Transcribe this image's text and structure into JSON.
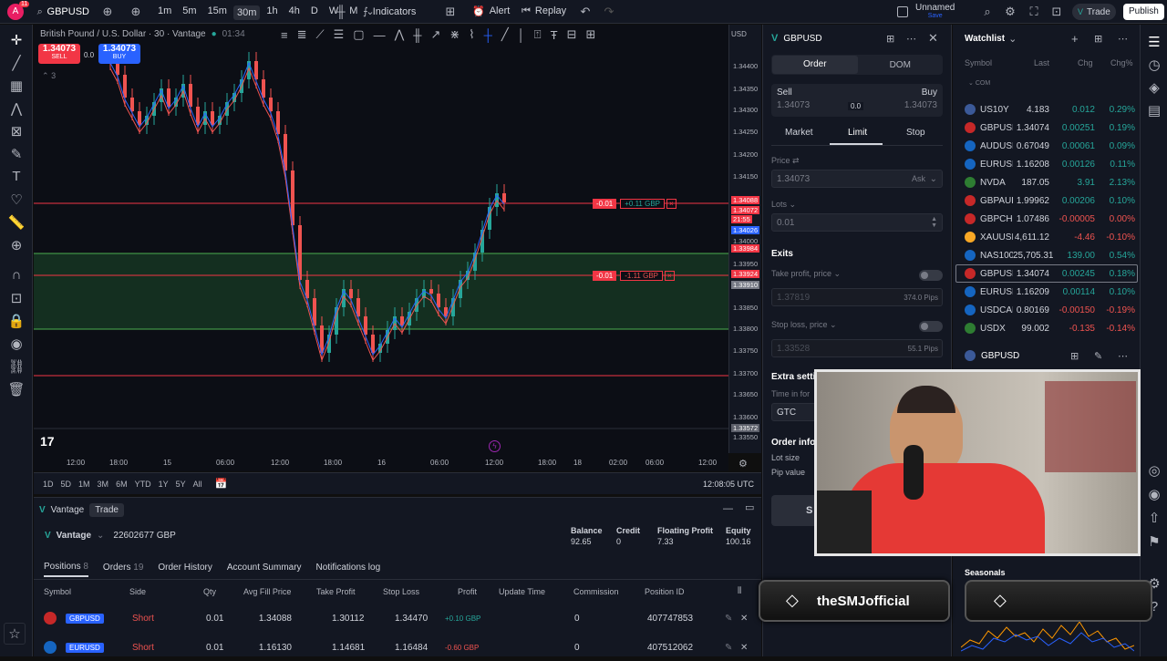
{
  "top_toolbar": {
    "symbol": "GBPUSD",
    "intervals": [
      "1m",
      "5m",
      "15m",
      "30m",
      "1h",
      "4h",
      "D",
      "W",
      "M"
    ],
    "active_interval": "30m",
    "indicators": "Indicators",
    "alert": "Alert",
    "replay": "Replay",
    "layout_name": "Unnamed",
    "layout_status": "Save",
    "trade": "Trade",
    "publish": "Publish",
    "avatar_badge": "11"
  },
  "chart": {
    "legend_title": "British Pound / U.S. Dollar · 30 · Vantage",
    "legend_time": "01:34",
    "sell_price": "1.34073",
    "sell_label": "SELL",
    "spread": "0.0",
    "buy_price": "1.34073",
    "buy_label": "BUY",
    "collapse_count": "3",
    "currency": "USD",
    "price_scale": [
      "1.34400",
      "1.34350",
      "1.34300",
      "1.34250",
      "1.34200",
      "1.34150",
      "1.34088",
      "1.34072",
      "21:55",
      "1.34026",
      "1.34000",
      "1.33984",
      "1.33950",
      "1.33924",
      "1.33910",
      "1.33850",
      "1.33800",
      "1.33750",
      "1.33700",
      "1.33650",
      "1.33600",
      "1.33572",
      "1.33550"
    ],
    "order_line_1": {
      "qty": "-0.01",
      "pnl": "+0.11 GBP"
    },
    "order_line_2": {
      "qty": "-0.01",
      "pnl": "-1.11 GBP"
    },
    "time_axis": [
      "12:00",
      "18:00",
      "15",
      "06:00",
      "12:00",
      "18:00",
      "16",
      "06:00",
      "12:00",
      "18:00",
      "18",
      "02:00",
      "06:00",
      "12:00"
    ],
    "ranges": [
      "1D",
      "5D",
      "1M",
      "3M",
      "6M",
      "YTD",
      "1Y",
      "5Y",
      "All"
    ],
    "clock": "12:08:05 UTC"
  },
  "order_panel": {
    "symbol": "GBPUSD",
    "tab_order": "Order",
    "tab_dom": "DOM",
    "sell_label": "Sell",
    "sell_price": "1.34073",
    "spread": "0.0",
    "buy_label": "Buy",
    "buy_price": "1.34073",
    "type_market": "Market",
    "type_limit": "Limit",
    "type_stop": "Stop",
    "price_label": "Price",
    "price_value": "1.34073",
    "price_suffix": "Ask",
    "lots_label": "Lots",
    "lots_value": "0.01",
    "exits_label": "Exits",
    "tp_label": "Take profit, price",
    "tp_value": "1.37819",
    "tp_pips": "374.0 Pips",
    "sl_label": "Stop loss, price",
    "sl_value": "1.33528",
    "sl_pips": "55.1 Pips",
    "extra_label": "Extra setti",
    "tif_label": "Time in for",
    "tif_value": "GTC",
    "order_info_label": "Order info",
    "lot_size_label": "Lot size",
    "pip_value_label": "Pip value",
    "submit_partial": "S"
  },
  "watchlist": {
    "title": "Watchlist",
    "headers": {
      "symbol": "Symbol",
      "last": "Last",
      "chg": "Chg",
      "chgp": "Chg%"
    },
    "section": "COM",
    "rows": [
      {
        "sym": "US10Y",
        "last": "4.183",
        "chg": "0.012",
        "chgp": "0.29%",
        "color": "#26a69a"
      },
      {
        "sym": "GBPUSD",
        "last": "1.34074",
        "chg": "0.00251",
        "chgp": "0.19%",
        "color": "#26a69a"
      },
      {
        "sym": "AUDUSD",
        "last": "0.67049",
        "chg": "0.00061",
        "chgp": "0.09%",
        "color": "#26a69a"
      },
      {
        "sym": "EURUSD",
        "last": "1.16208",
        "chg": "0.00126",
        "chgp": "0.11%",
        "color": "#26a69a"
      },
      {
        "sym": "NVDA",
        "last": "187.05",
        "chg": "3.91",
        "chgp": "2.13%",
        "color": "#26a69a"
      },
      {
        "sym": "GBPAUD",
        "last": "1.99962",
        "chg": "0.00206",
        "chgp": "0.10%",
        "color": "#26a69a"
      },
      {
        "sym": "GBPCHF",
        "last": "1.07486",
        "chg": "-0.00005",
        "chgp": "0.00%",
        "color": "#ef5350"
      },
      {
        "sym": "XAUUSD",
        "last": "4,611.12",
        "chg": "-4.46",
        "chgp": "-0.10%",
        "color": "#ef5350"
      },
      {
        "sym": "NAS100",
        "last": "25,705.31",
        "chg": "139.00",
        "chgp": "0.54%",
        "color": "#26a69a"
      },
      {
        "sym": "GBPUSD",
        "last": "1.34074",
        "chg": "0.00245",
        "chgp": "0.18%",
        "color": "#26a69a"
      },
      {
        "sym": "EURUSD",
        "last": "1.16209",
        "chg": "0.00114",
        "chgp": "0.10%",
        "color": "#26a69a"
      },
      {
        "sym": "USDCAD",
        "last": "0.80169",
        "chg": "-0.00150",
        "chgp": "-0.19%",
        "color": "#ef5350"
      },
      {
        "sym": "USDX",
        "last": "99.002",
        "chg": "-0.135",
        "chgp": "-0.14%",
        "color": "#ef5350"
      }
    ],
    "detail_symbol": "GBPUSD",
    "seasonals": "Seasonals"
  },
  "bottom_panel": {
    "broker": "Vantage",
    "tab_trade": "Trade",
    "account_broker": "Vantage",
    "account_id": "22602677 GBP",
    "balance_label": "Balance",
    "balance_value": "92.65",
    "credit_label": "Credit",
    "credit_value": "0",
    "floating_label": "Floating Profit",
    "floating_value": "7.33",
    "equity_label": "Equity",
    "equity_value": "100.16",
    "tabs": [
      "Positions",
      "Orders",
      "Order History",
      "Account Summary",
      "Notifications log"
    ],
    "positions_count": "8",
    "orders_count": "19",
    "columns": [
      "Symbol",
      "Side",
      "Qty",
      "Avg Fill Price",
      "Take Profit",
      "Stop Loss",
      "Profit",
      "Update Time",
      "Commission",
      "Position ID"
    ],
    "rows": [
      {
        "symbol": "GBPUSD",
        "side": "Short",
        "qty": "0.01",
        "avg": "1.34088",
        "tp": "1.30112",
        "sl": "1.34470",
        "profit": "+0.10 GBP",
        "commission": "0",
        "id": "407747853"
      },
      {
        "symbol": "EURUSD",
        "side": "Short",
        "qty": "0.01",
        "avg": "1.16130",
        "tp": "1.14681",
        "sl": "1.16484",
        "profit": "-0.60 GBP",
        "commission": "0",
        "id": "407512062"
      }
    ]
  },
  "stream_overlay": {
    "banner": "theSMJofficial"
  }
}
